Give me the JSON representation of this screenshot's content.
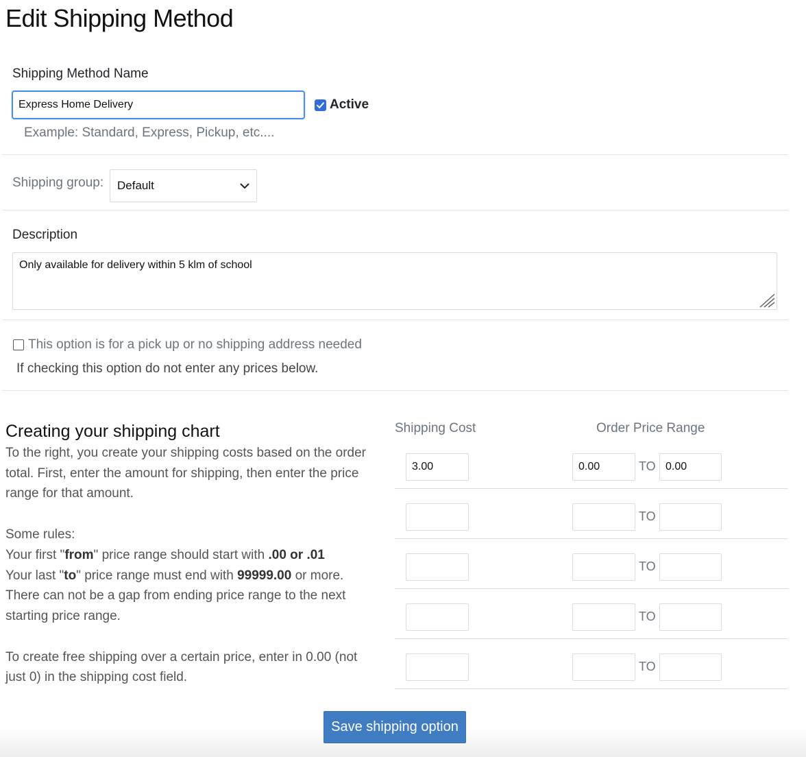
{
  "page": {
    "title": "Edit Shipping Method"
  },
  "name_section": {
    "label": "Shipping Method Name",
    "value": "Express Home Delivery",
    "active_label": "Active",
    "active_checked": true,
    "example": "Example: Standard, Express, Pickup, etc...."
  },
  "group_section": {
    "label": "Shipping group:",
    "selected": "Default"
  },
  "description_section": {
    "label": "Description",
    "value": "Only available for delivery within 5 klm of school"
  },
  "pickup_section": {
    "checkbox_label": "This option is for a pick up or no shipping address needed",
    "checked": false,
    "note": "If checking this option do not enter any prices below."
  },
  "chart_help": {
    "heading": "Creating your shipping chart",
    "intro_line1": "To the right, you create your shipping costs based on the order",
    "intro_line2": "total. First, enter the amount for shipping, then enter the price",
    "intro_line3": "range for that amount.",
    "rules_heading": "Some rules:",
    "rule1_pre": "Your first \"",
    "rule1_bold1": "from",
    "rule1_mid": "\" price range should start with ",
    "rule1_bold2": ".00 or .01",
    "rule2_pre": "Your last \"",
    "rule2_bold1": "to",
    "rule2_mid": "\" price range must end with ",
    "rule2_bold2": "99999.00",
    "rule2_post": " or more.",
    "rule3_line1": "There can not be a gap from ending price range to the next",
    "rule3_line2": "starting price range.",
    "free_line1": "To create free shipping over a certain price, enter in 0.00 (not",
    "free_line2": "just 0) in the shipping cost field."
  },
  "shipping_table": {
    "cost_header": "Shipping Cost",
    "range_header": "Order Price Range",
    "to_label": "TO",
    "rows": [
      {
        "cost": "3.00",
        "from": "0.00",
        "to": "0.00"
      },
      {
        "cost": "",
        "from": "",
        "to": ""
      },
      {
        "cost": "",
        "from": "",
        "to": ""
      },
      {
        "cost": "",
        "from": "",
        "to": ""
      },
      {
        "cost": "",
        "from": "",
        "to": ""
      }
    ]
  },
  "actions": {
    "save_label": "Save shipping option"
  }
}
